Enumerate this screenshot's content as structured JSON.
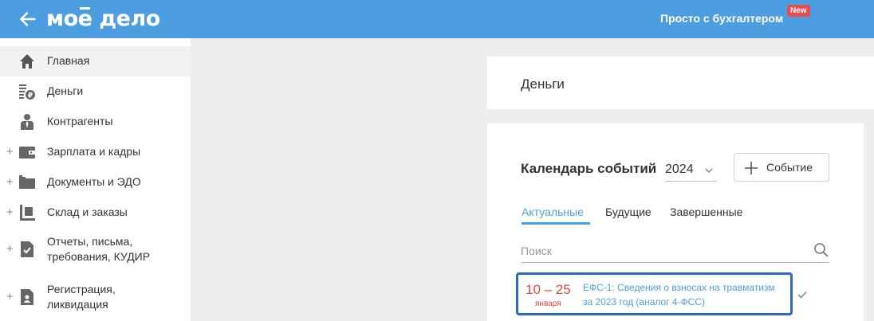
{
  "header": {
    "logo_left": "мо",
    "logo_e": "е",
    "logo_right": " дело",
    "promo_text": "Просто с бухгалтером",
    "promo_badge": "New"
  },
  "sidebar": {
    "items": [
      {
        "label": "Главная",
        "icon": "home-icon",
        "expandable": false,
        "active": true
      },
      {
        "label": "Деньги",
        "icon": "money-icon",
        "expandable": false
      },
      {
        "label": "Контрагенты",
        "icon": "contractor-icon",
        "expandable": false
      },
      {
        "label": "Зарплата и кадры",
        "icon": "wallet-icon",
        "expandable": true
      },
      {
        "label": "Документы и ЭДО",
        "icon": "folder-icon",
        "expandable": true
      },
      {
        "label": "Склад и заказы",
        "icon": "warehouse-icon",
        "expandable": true
      },
      {
        "label": "Отчеты, письма, требования, КУДИР",
        "icon": "report-icon",
        "expandable": true
      },
      {
        "label": "Регистрация, ликвидация",
        "icon": "registration-icon",
        "expandable": true
      }
    ]
  },
  "money_card": {
    "title": "Деньги"
  },
  "calendar": {
    "title": "Календарь событий",
    "year": "2024",
    "add_button_label": "Событие",
    "tabs": [
      {
        "label": "Актуальные",
        "active": true
      },
      {
        "label": "Будущие"
      },
      {
        "label": "Завершенные"
      }
    ],
    "search_placeholder": "Поиск",
    "events": [
      {
        "dates": "10 – 25",
        "month": "января",
        "text": "ЕФС-1: Сведения о взносах на травматизм за 2023 год (аналог 4-ФСС)"
      }
    ]
  },
  "colors": {
    "header_bg": "#4d9ee0",
    "accent": "#4d9ee0",
    "badge_red": "#e84c4c",
    "date_red": "#e04848",
    "focus_border": "#2d6bbf"
  }
}
